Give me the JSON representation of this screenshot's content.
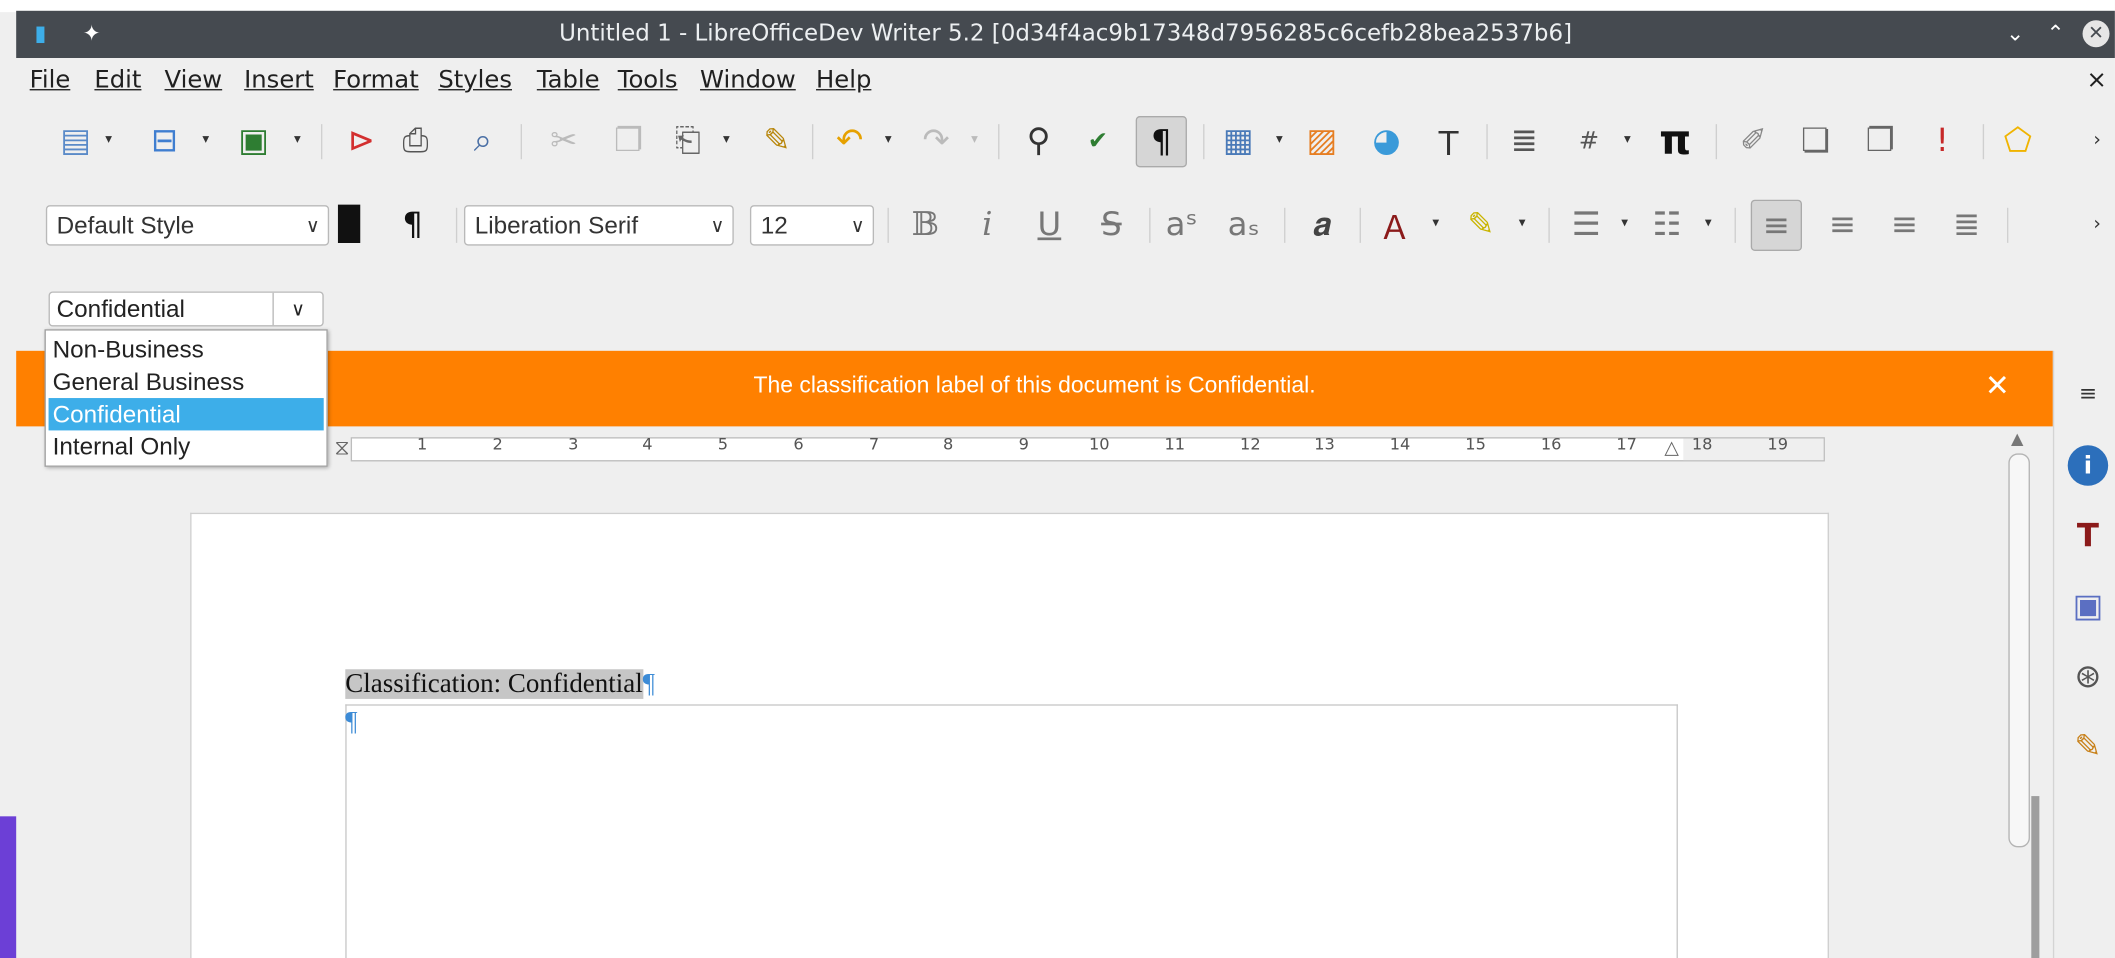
{
  "window": {
    "title": "Untitled 1 - LibreOfficeDev Writer 5.2 [0d34f4ac9b17348d7956285c6cefb28bea2537b6]"
  },
  "menu": [
    "File",
    "Edit",
    "View",
    "Insert",
    "Format",
    "Styles",
    "Table",
    "Tools",
    "Window",
    "Help"
  ],
  "menu_close": "×",
  "formatting": {
    "paragraph_style": "Default Style",
    "font_name": "Liberation Serif",
    "font_size": "12"
  },
  "classification": {
    "current": "Confidential",
    "options": [
      "Non-Business",
      "General Business",
      "Confidential",
      "Internal Only"
    ],
    "selected_index": 2
  },
  "infobar": {
    "message": "The classification label of this document is Confidential.",
    "close": "✕"
  },
  "ruler": {
    "numbers": [
      "1",
      "2",
      "3",
      "4",
      "5",
      "6",
      "7",
      "8",
      "9",
      "10",
      "11",
      "12",
      "13",
      "14",
      "15",
      "16",
      "17",
      "18",
      "19"
    ]
  },
  "document": {
    "classification_line": "Classification: Confidential",
    "pilcrow": "¶"
  },
  "colors": {
    "titlebar": "#454a50",
    "infobar": "#ff8000",
    "selection": "#3daee9",
    "accent_purple": "#6c3fd6"
  }
}
